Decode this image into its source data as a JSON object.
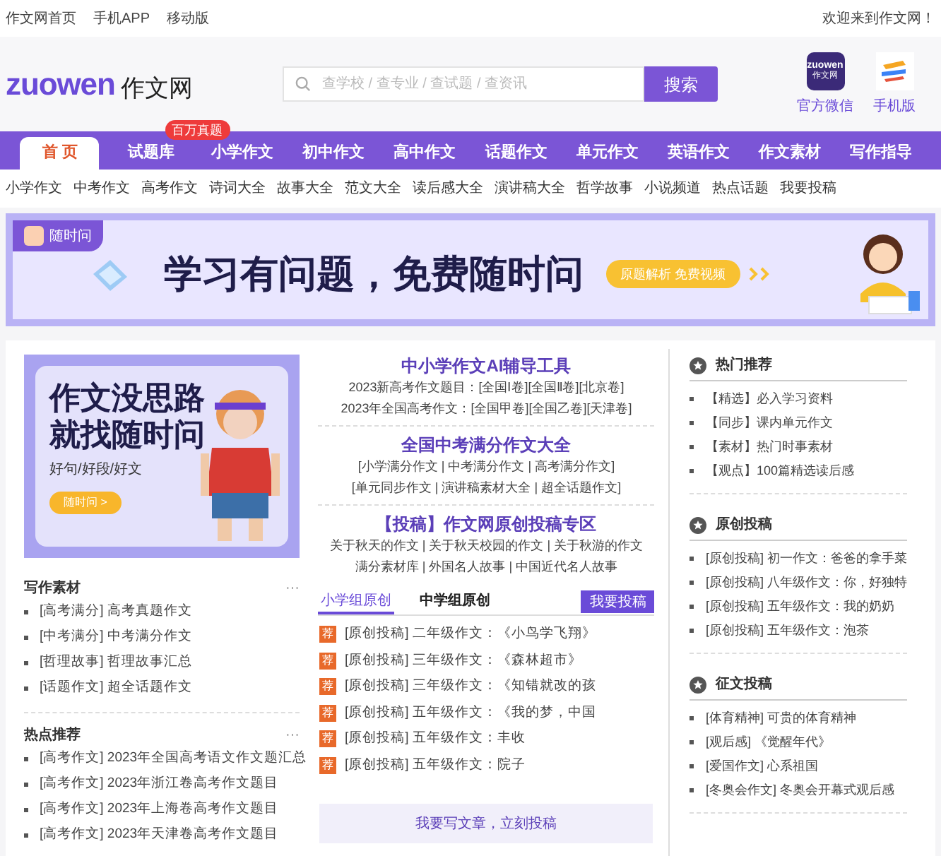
{
  "top_bar": {
    "links": [
      "作文网首页",
      "手机APP",
      "移动版"
    ],
    "welcome": "欢迎来到作文网！"
  },
  "header": {
    "logo_latin": "zuowen",
    "logo_cn": "作文网",
    "search": {
      "placeholder": "查学校 / 查专业 / 查试题 / 查资讯",
      "button": "搜索"
    },
    "apps": [
      {
        "kind": "wechat",
        "icon_text": "zuowen",
        "icon_sub": "作文网",
        "label": "官方微信"
      },
      {
        "kind": "mobile",
        "label": "手机版"
      }
    ]
  },
  "nav": {
    "items": [
      {
        "label": "首 页",
        "selected": true
      },
      {
        "label": "试题库",
        "selected": false,
        "badge": "百万真题"
      },
      {
        "label": "小学作文",
        "selected": false
      },
      {
        "label": "初中作文",
        "selected": false
      },
      {
        "label": "高中作文",
        "selected": false
      },
      {
        "label": "话题作文",
        "selected": false
      },
      {
        "label": "单元作文",
        "selected": false
      },
      {
        "label": "英语作文",
        "selected": false
      },
      {
        "label": "作文素材",
        "selected": false
      },
      {
        "label": "写作指导",
        "selected": false
      }
    ]
  },
  "sub_nav": [
    "小学作文",
    "中考作文",
    "高考作文",
    "诗词大全",
    "故事大全",
    "范文大全",
    "读后感大全",
    "演讲稿大全",
    "哲学故事",
    "小说频道",
    "热点话题",
    "我要投稿"
  ],
  "banner": {
    "tag": "随时问",
    "headline": "学习有问题，免费随时问",
    "button": "原题解析 免费视频"
  },
  "left": {
    "ad": {
      "title_lines": [
        "作文没思路",
        "就找随时问"
      ],
      "subtitle": "好句/好段/好文",
      "button": "随时问 >"
    },
    "sections": [
      {
        "title": "写作素材",
        "more": "···",
        "items": [
          "[高考满分] 高考真题作文",
          "[中考满分] 中考满分作文",
          "[哲理故事] 哲理故事汇总",
          "[话题作文] 超全话题作文"
        ]
      },
      {
        "title": "热点推荐",
        "more": "···",
        "items": [
          "[高考作文] 2023年全国高考语文作文题汇总",
          "[高考作文] 2023年浙江卷高考作文题目",
          "[高考作文] 2023年上海卷高考作文题目",
          "[高考作文] 2023年天津卷高考作文题目"
        ]
      }
    ]
  },
  "middle": {
    "blocks": [
      {
        "title": "中小学作文AI辅导工具",
        "lines": [
          "2023新高考作文题目：[全国Ⅰ卷][全国Ⅱ卷][北京卷]",
          "2023年全国高考作文：[全国甲卷][全国乙卷][天津卷]"
        ]
      },
      {
        "title": "全国中考满分作文大全",
        "lines": [
          "[小学满分作文 | 中考满分作文 | 高考满分作文]",
          "[单元同步作文 | 演讲稿素材大全 | 超全话题作文]"
        ]
      },
      {
        "title": "【投稿】作文网原创投稿专区",
        "lines": [
          "关于秋天的作文 | 关于秋天校园的作文 | 关于秋游的作文",
          "满分素材库 | 外国名人故事 | 中国近代名人故事"
        ]
      }
    ],
    "tabs": [
      {
        "label": "小学组原创",
        "selected": true
      },
      {
        "label": "中学组原创",
        "selected": false
      }
    ],
    "submit_button": "我要投稿",
    "posts": [
      {
        "badge": "荐",
        "text": "[原创投稿] 二年级作文：《小鸟学飞翔》"
      },
      {
        "badge": "荐",
        "text": "[原创投稿] 三年级作文：《森林超市》"
      },
      {
        "badge": "荐",
        "text": "[原创投稿] 三年级作文：《知错就改的孩"
      },
      {
        "badge": "荐",
        "text": "[原创投稿] 五年级作文：《我的梦，中国"
      },
      {
        "badge": "荐",
        "text": "[原创投稿] 五年级作文：丰收"
      },
      {
        "badge": "荐",
        "text": "[原创投稿] 五年级作文：院子"
      }
    ],
    "cta": "我要写文章，立刻投稿"
  },
  "right": {
    "sections": [
      {
        "title": "热门推荐",
        "items": [
          "【精选】必入学习资料",
          "【同步】课内单元作文",
          "【素材】热门时事素材",
          "【观点】100篇精选读后感"
        ]
      },
      {
        "title": "原创投稿",
        "items": [
          "[原创投稿] 初一作文：爸爸的拿手菜",
          "[原创投稿] 八年级作文：你，好独特",
          "[原创投稿] 五年级作文：我的奶奶",
          "[原创投稿] 五年级作文：泡茶"
        ]
      },
      {
        "title": "征文投稿",
        "items": [
          "[体育精神] 可贵的体育精神",
          "[观后感] 《觉醒年代》",
          "[爱国作文] 心系祖国",
          "[冬奥会作文] 冬奥会开幕式观后感"
        ]
      }
    ]
  }
}
